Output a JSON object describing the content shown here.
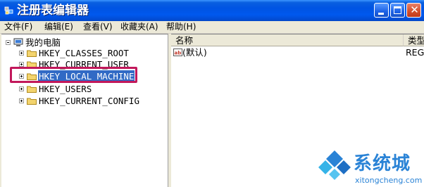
{
  "window": {
    "title": "注册表编辑器",
    "colors": {
      "titlebar": "#0054e3",
      "highlight_box": "#c2185b",
      "selection": "#316ac5",
      "watermark": "#2a83d6"
    }
  },
  "menu": {
    "items": [
      {
        "label": "文件(F)"
      },
      {
        "label": "编辑(E)"
      },
      {
        "label": "查看(V)"
      },
      {
        "label": "收藏夹(A)"
      },
      {
        "label": "帮助(H)"
      }
    ]
  },
  "tree": {
    "root": {
      "label": "我的电脑",
      "icon": "computer-icon"
    },
    "keys": [
      {
        "label": "HKEY_CLASSES_ROOT",
        "icon": "folder-icon"
      },
      {
        "label": "HKEY_CURRENT_USER",
        "icon": "folder-icon"
      },
      {
        "label": "HKEY_LOCAL_MACHINE",
        "icon": "folder-icon",
        "selected": true
      },
      {
        "label": "HKEY_USERS",
        "icon": "folder-icon"
      },
      {
        "label": "HKEY_CURRENT_CONFIG",
        "icon": "folder-icon"
      }
    ]
  },
  "values_list": {
    "columns": [
      {
        "label": "名称"
      },
      {
        "label": "类型"
      }
    ],
    "rows": [
      {
        "name": "(默认)",
        "type": "REG_SZ",
        "icon": "string-value-icon"
      }
    ]
  },
  "watermark": {
    "brand": "系统城",
    "url": "xitongcheng.com"
  }
}
